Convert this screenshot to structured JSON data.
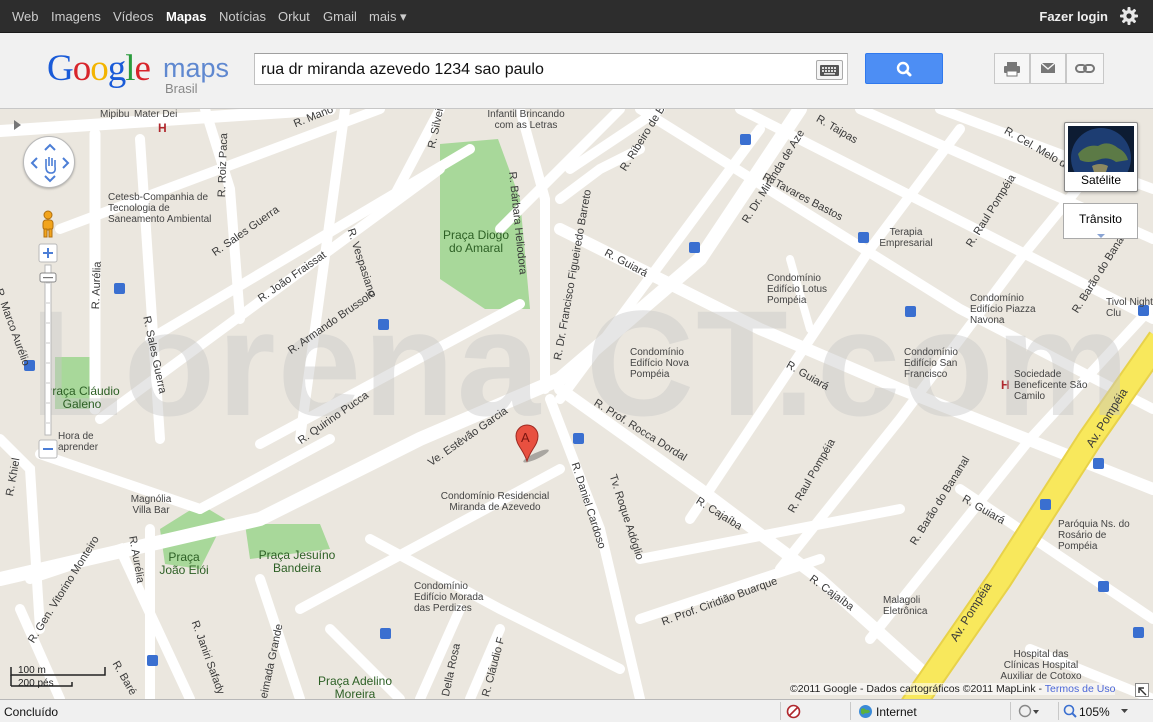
{
  "topbar": {
    "links": [
      "Web",
      "Imagens",
      "Vídeos",
      "Mapas",
      "Notícias",
      "Orkut",
      "Gmail",
      "mais ▾"
    ],
    "active": "Mapas",
    "login": "Fazer login"
  },
  "header": {
    "logo_google": "Google",
    "logo_maps": "maps",
    "logo_region": "Brasil",
    "search_value": "rua dr miranda azevedo 1234 sao paulo"
  },
  "colors": {
    "topbar_bg": "#2d2d2d",
    "search_button": "#4d8ef4",
    "map_bg": "#ebe7df",
    "road": "#ffffff",
    "park": "#a8d89a",
    "highway": "#f8e85c",
    "marker": "#e85040"
  },
  "map": {
    "watermark": "Lorena CT.com",
    "marker_letter": "A",
    "roads": [
      "R. Mano",
      "R. Silveira",
      "R. Ribeiro de Ba",
      "R. Dr. Miranda de Aze",
      "R. Taipas",
      "R. Cel. Melo de",
      "R. Roiz Paca",
      "R. Sales Guerra",
      "R. João Fraissat",
      "R. Vespasiano",
      "R. Bárbara Heliodora",
      "R. Tavares Bastos",
      "R. Raul Pompéia",
      "R. Barão do Banan",
      "R. Aurélia",
      "R. Marco Aurélio",
      "R. Armando Brussolo",
      "R. Dr. Francisco Figueiredo Barreto",
      "R. Guiará",
      "R. Quirino Pucca",
      "Ve. Estêvão Garcia",
      "R. Prof. Rocca Dordal",
      "R. Guiará",
      "R. Raul Pompéia",
      "R. Barão do Bananal",
      "R. Guiará",
      "Av. Pompéia",
      "R. Khiel",
      "R. Cajaíba",
      "R. Daniel Cardoso",
      "Tv. Roque Adóglio",
      "R. Sales Guerra",
      "R. Gen. Vitorino Monteiro",
      "R. Aurélia",
      "R. Prof. Ciridião Buarque",
      "R. Cajaíba",
      "R. Janiri Safady",
      "R. Baré",
      "eimada Grande",
      "Della Rosa",
      "R. Cláudio F",
      "Av. Pompéia"
    ],
    "places": [
      "Mipibu",
      "Mater Dei",
      "Infantil Brincando com as Letras",
      "Cetesb-Companhia de Tecnologia de Saneamento Ambiental",
      "Praça Diogo do Amaral",
      "Terapia Empresarial",
      "Condomínio Edifício Lotus Pompéia",
      "Condomínio Edifício Piazza Navona",
      "Tivol Night Clu",
      "Condomínio Edifício Nova Pompéia",
      "Condomínio Edifício San Francisco",
      "Sociedade Beneficente São Camilo",
      "Praça Cláudio Galeno",
      "Hora de aprender",
      "Magnólia Villa Bar",
      "Condomínio Residencial Miranda de Azevedo",
      "Praça João Elói",
      "Praça Jesuíno Bandeira",
      "Paróquia Ns. do Rosário de Pompéia",
      "Condomínio Edifício Morada das Perdizes",
      "Malagoli Eletrônica",
      "Praça Adelino Moreira",
      "Hospital das Clínicas Hospital Auxiliar de Cotoxo"
    ],
    "satellite": "Satélite",
    "traffic": "Trânsito",
    "scale_m": "100 m",
    "scale_ft": "200 pés",
    "copyright": "©2011 Google - Dados cartográficos ©2011 MapLink -",
    "terms": "Termos de Uso"
  },
  "statusbar": {
    "left": "Concluído",
    "zone": "Internet",
    "zoom": "105%"
  }
}
